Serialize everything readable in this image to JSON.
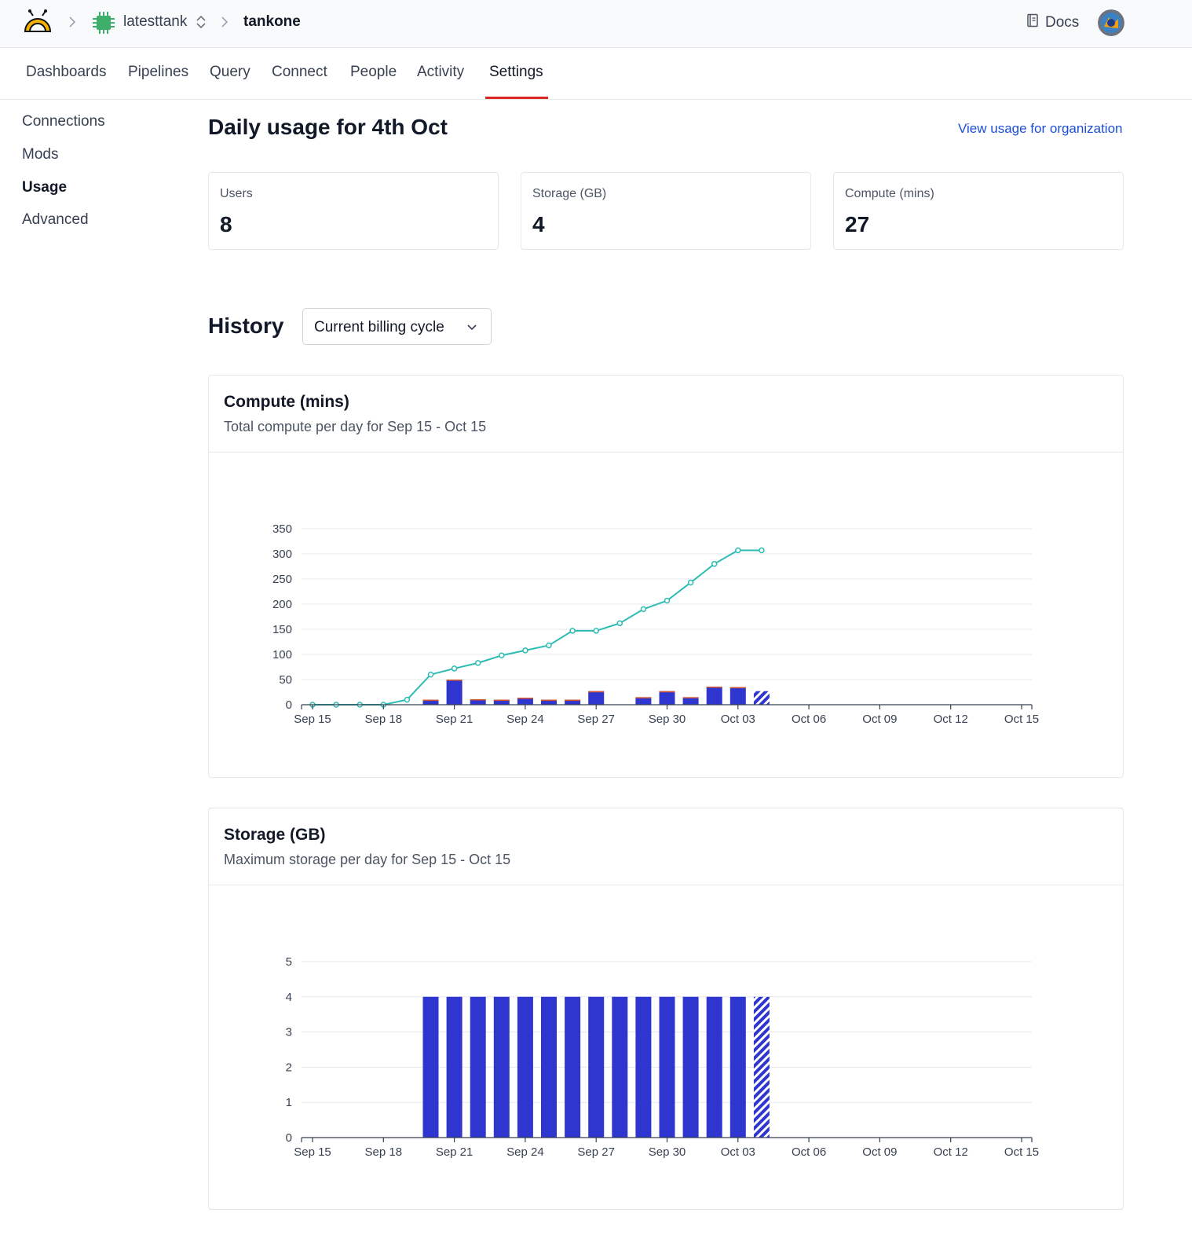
{
  "topbar": {
    "logo_icon": "bee-logo-icon",
    "workspace_icon": "chip-icon",
    "organization": "latesttank",
    "workspace": "tankone",
    "docs_label": "Docs",
    "docs_icon": "book-icon"
  },
  "tabs": [
    {
      "label": "Dashboards"
    },
    {
      "label": "Pipelines"
    },
    {
      "label": "Query"
    },
    {
      "label": "Connect"
    },
    {
      "label": "People"
    },
    {
      "label": "Activity"
    },
    {
      "label": "Settings",
      "active": true
    }
  ],
  "sidebar": {
    "items": [
      {
        "label": "Connections"
      },
      {
        "label": "Mods"
      },
      {
        "label": "Usage",
        "active": true
      },
      {
        "label": "Advanced"
      }
    ]
  },
  "main": {
    "title": "Daily usage for 4th Oct",
    "org_link": "View usage for organization",
    "stats": [
      {
        "label": "Users",
        "value": "8"
      },
      {
        "label": "Storage (GB)",
        "value": "4"
      },
      {
        "label": "Compute (mins)",
        "value": "27"
      }
    ],
    "history_title": "History",
    "range_select": "Current billing cycle"
  },
  "colors": {
    "bar": "#2f35cf",
    "line": "#2cbcb4",
    "bar_top_accent": "#dc5a2a",
    "accent_tab": "#dc2626",
    "link": "#1d4ed8"
  },
  "chart_data": [
    {
      "type": "bar",
      "title": "Compute (mins)",
      "subtitle": "Total compute per day for Sep 15 - Oct 15",
      "x_tick_labels": [
        "Sep 15",
        "Sep 18",
        "Sep 21",
        "Sep 24",
        "Sep 27",
        "Sep 30",
        "Oct 03",
        "Oct 06",
        "Oct 09",
        "Oct 12",
        "Oct 15"
      ],
      "y_ticks": [
        0,
        50,
        100,
        150,
        200,
        250,
        300,
        350
      ],
      "ylim": [
        0,
        350
      ],
      "x": [
        "Sep 15",
        "Sep 16",
        "Sep 17",
        "Sep 18",
        "Sep 19",
        "Sep 20",
        "Sep 21",
        "Sep 22",
        "Sep 23",
        "Sep 24",
        "Sep 25",
        "Sep 26",
        "Sep 27",
        "Sep 28",
        "Sep 29",
        "Sep 30",
        "Oct 01",
        "Oct 02",
        "Oct 03",
        "Oct 04",
        "Oct 05",
        "Oct 06",
        "Oct 07",
        "Oct 08",
        "Oct 09",
        "Oct 10",
        "Oct 11",
        "Oct 12",
        "Oct 13",
        "Oct 14",
        "Oct 15"
      ],
      "series": [
        {
          "kind": "bar",
          "values": [
            0,
            0,
            0,
            0,
            0,
            10,
            50,
            11,
            10,
            14,
            10,
            10,
            27,
            0,
            15,
            27,
            15,
            36,
            35,
            27,
            null,
            null,
            null,
            null,
            null,
            null,
            null,
            null,
            null,
            null,
            null
          ],
          "partial_last": true
        },
        {
          "kind": "line",
          "values": [
            0,
            0,
            0,
            0,
            10,
            60,
            72,
            83,
            98,
            108,
            118,
            147,
            147,
            162,
            190,
            207,
            243,
            280,
            307,
            307,
            null,
            null,
            null,
            null,
            null,
            null,
            null,
            null,
            null,
            null,
            null
          ]
        }
      ],
      "grid": true
    },
    {
      "type": "bar",
      "title": "Storage (GB)",
      "subtitle": "Maximum storage per day for Sep 15 - Oct 15",
      "x_tick_labels": [
        "Sep 15",
        "Sep 18",
        "Sep 21",
        "Sep 24",
        "Sep 27",
        "Sep 30",
        "Oct 03",
        "Oct 06",
        "Oct 09",
        "Oct 12",
        "Oct 15"
      ],
      "y_ticks": [
        0,
        1,
        2,
        3,
        4,
        5
      ],
      "ylim": [
        0,
        5
      ],
      "x": [
        "Sep 15",
        "Sep 16",
        "Sep 17",
        "Sep 18",
        "Sep 19",
        "Sep 20",
        "Sep 21",
        "Sep 22",
        "Sep 23",
        "Sep 24",
        "Sep 25",
        "Sep 26",
        "Sep 27",
        "Sep 28",
        "Sep 29",
        "Sep 30",
        "Oct 01",
        "Oct 02",
        "Oct 03",
        "Oct 04",
        "Oct 05",
        "Oct 06",
        "Oct 07",
        "Oct 08",
        "Oct 09",
        "Oct 10",
        "Oct 11",
        "Oct 12",
        "Oct 13",
        "Oct 14",
        "Oct 15"
      ],
      "series": [
        {
          "kind": "bar",
          "values": [
            0,
            0,
            0,
            0,
            0,
            4,
            4,
            4,
            4,
            4,
            4,
            4,
            4,
            4,
            4,
            4,
            4,
            4,
            4,
            4,
            null,
            null,
            null,
            null,
            null,
            null,
            null,
            null,
            null,
            null,
            null
          ],
          "partial_last": true
        }
      ],
      "grid": true
    }
  ]
}
